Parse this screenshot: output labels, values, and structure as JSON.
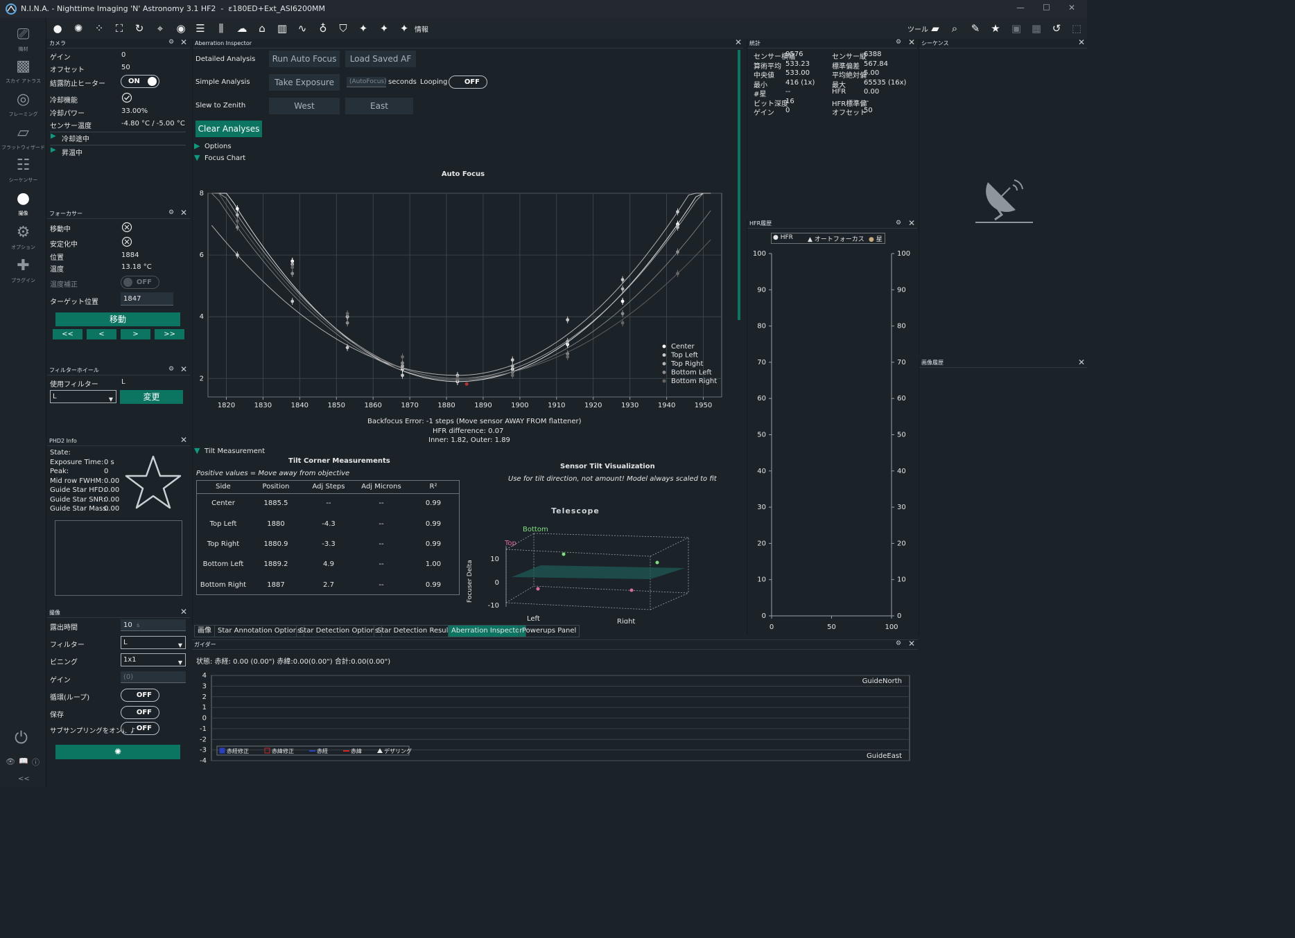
{
  "window": {
    "title": "N.I.N.A. - Nighttime Imaging 'N' Astronomy 3.1 HF2",
    "profile": "ε180ED+Ext_ASI6200MM"
  },
  "toolbar": {
    "info_label": "情報",
    "tools_label": "ツール",
    "left_icons": [
      "circle-icon",
      "aperture-icon",
      "dots-icon",
      "frame-icon",
      "rotate-icon",
      "telescope-icon",
      "target-icon",
      "list-icon",
      "sliders-icon",
      "cloud-icon",
      "observatory-icon",
      "bar-chart-icon",
      "wave-icon",
      "bulb-icon",
      "shield-icon",
      "puzzle-icon",
      "puzzle-icon",
      "puzzle-icon"
    ],
    "right_icons": [
      "flat-icon",
      "zoom-icon",
      "brush-icon",
      "star-icon",
      "af-icon",
      "grid-icon",
      "history-icon",
      "crop-icon"
    ]
  },
  "rail": {
    "items": [
      {
        "label": "機材",
        "icon": "equipment-icon"
      },
      {
        "label": "スカイ アトラス",
        "icon": "map-icon"
      },
      {
        "label": "フレーミング",
        "icon": "framing-icon"
      },
      {
        "label": "フラットウィザード",
        "icon": "flat-wizard-icon"
      },
      {
        "label": "シーケンサー",
        "icon": "sequencer-icon"
      },
      {
        "label": "撮像",
        "icon": "imaging-icon"
      },
      {
        "label": "オプション",
        "icon": "gears-icon"
      },
      {
        "label": "プラグイン",
        "icon": "plugin-icon"
      }
    ],
    "collapse_label": "<<"
  },
  "camera": {
    "title": "カメラ",
    "rows": [
      {
        "label": "ゲイン",
        "value": "0"
      },
      {
        "label": "オフセット",
        "value": "50"
      },
      {
        "label": "結露防止ヒーター",
        "value": "ON"
      },
      {
        "label": "冷却機能",
        "value": ""
      },
      {
        "label": "冷却パワー",
        "value": "33.00%"
      },
      {
        "label": "センサー温度",
        "value": "-4.80 °C / -5.00 °C"
      }
    ],
    "cooling": "冷却途中",
    "warming": "昇温中"
  },
  "focuser": {
    "title": "フォーカサー",
    "rows": [
      {
        "label": "移動中",
        "value": ""
      },
      {
        "label": "安定化中",
        "value": ""
      },
      {
        "label": "位置",
        "value": "1884"
      },
      {
        "label": "温度",
        "value": "13.18 °C"
      },
      {
        "label": "温度補正",
        "value": "OFF"
      }
    ],
    "target_label": "ターゲット位置",
    "target_value": "1847",
    "move_label": "移動",
    "step_buttons": [
      "<<",
      "<",
      ">",
      ">>"
    ]
  },
  "filterwheel": {
    "title": "フィルターホイール",
    "in_use_label": "使用フィルター",
    "in_use_value": "L",
    "selected": "L",
    "change_label": "変更"
  },
  "phd2": {
    "title": "PHD2 Info",
    "rows": [
      {
        "label": "State:",
        "value": ""
      },
      {
        "label": "Exposure Time:",
        "value": "0 s"
      },
      {
        "label": "Peak:",
        "value": "0"
      },
      {
        "label": "Mid row FWHM:",
        "value": "0.00"
      },
      {
        "label": "Guide Star HFD:",
        "value": "0.00"
      },
      {
        "label": "Guide Star SNR:",
        "value": "0.00"
      },
      {
        "label": "Guide Star Mass:",
        "value": "0.00"
      }
    ]
  },
  "imaging": {
    "title": "撮像",
    "exposure_label": "露出時間",
    "exposure_value": "10",
    "exposure_unit": "s",
    "filter_label": "フィルター",
    "filter_value": "L",
    "binning_label": "ビニング",
    "binning_value": "1x1",
    "gain_label": "ゲイン",
    "gain_placeholder": "(0)",
    "loop_label": "循環(ループ)",
    "loop_value": "OFF",
    "save_label": "保存",
    "save_value": "OFF",
    "subsample_label": "サブサンプリングをオンにす",
    "subsample_value": "OFF"
  },
  "aberration": {
    "title": "Aberration Inspector",
    "detailed_label": "Detailed Analysis",
    "run_af": "Run Auto Focus",
    "load_af": "Load Saved AF",
    "simple_label": "Simple Analysis",
    "take_exposure": "Take Exposure",
    "autofocus_placeholder": "(AutoFocus)",
    "seconds": "seconds",
    "looping_label": "Looping",
    "looping_value": "OFF",
    "slew_label": "Slew to Zenith",
    "west": "West",
    "east": "East",
    "clear": "Clear Analyses",
    "options": "Options",
    "focus_chart": "Focus Chart",
    "backfocus": "Backfocus Error: -1 steps (Move sensor AWAY FROM flattener)",
    "hfr_diff": "HFR difference: 0.07",
    "inner_outer": "Inner: 1.82, Outer: 1.89",
    "tilt_measurement": "Tilt Measurement",
    "tilt_title": "Tilt Corner Measurements",
    "tilt_note": "Positive values = Move away from objective",
    "tilt_headers": [
      "Side",
      "Position",
      "Adj Steps",
      "Adj Microns",
      "R²"
    ],
    "tilt_rows": [
      [
        "Center",
        "1885.5",
        "--",
        "--",
        "0.99"
      ],
      [
        "Top Left",
        "1880",
        "-4.3",
        "--",
        "0.99"
      ],
      [
        "Top Right",
        "1880.9",
        "-3.3",
        "--",
        "0.99"
      ],
      [
        "Bottom Left",
        "1889.2",
        "4.9",
        "--",
        "1.00"
      ],
      [
        "Bottom Right",
        "1887",
        "2.7",
        "--",
        "0.99"
      ]
    ],
    "viz_title": "Sensor Tilt Visualization",
    "viz_note": "Use for tilt direction, not amount! Model always scaled to fit",
    "viz_telescope": "Telescope",
    "viz_bottom": "Bottom",
    "viz_top": "Top",
    "viz_left": "Left",
    "viz_right": "Right",
    "viz_axis": "Focuser Delta",
    "viz_ticks": [
      "10",
      "0",
      "-10"
    ]
  },
  "chart_data": [
    {
      "type": "scatter",
      "title": "Auto Focus",
      "xlim": [
        1815,
        1955
      ],
      "ylim": [
        1.4,
        8
      ],
      "x_ticks": [
        1820,
        1830,
        1840,
        1850,
        1860,
        1870,
        1880,
        1890,
        1900,
        1910,
        1920,
        1930,
        1940,
        1950
      ],
      "y_ticks": [
        2,
        4,
        6,
        8
      ],
      "grid": true,
      "legend_position": "bottom-right",
      "series": [
        {
          "name": "Center",
          "color": "#ffffff",
          "x": [
            1823,
            1838,
            1853,
            1868,
            1883,
            1898,
            1913,
            1928,
            1943
          ],
          "y": [
            7.5,
            5.8,
            4.0,
            2.3,
            1.9,
            2.3,
            3.1,
            4.5,
            7.0
          ]
        },
        {
          "name": "Top Left",
          "color": "#c8c8c8",
          "x": [
            1823,
            1838,
            1853,
            1868,
            1883,
            1898,
            1913,
            1928,
            1943
          ],
          "y": [
            6.0,
            4.5,
            3.0,
            2.1,
            2.1,
            2.6,
            3.9,
            5.2,
            7.4
          ]
        },
        {
          "name": "Top Right",
          "color": "#b4b4b4",
          "x": [
            1823,
            1838,
            1853,
            1868,
            1883,
            1898,
            1913,
            1928,
            1943
          ],
          "y": [
            7.3,
            5.7,
            4.0,
            2.4,
            2.0,
            2.4,
            3.2,
            4.9,
            6.9
          ]
        },
        {
          "name": "Bottom Left",
          "color": "#8c8c8c",
          "x": [
            1823,
            1838,
            1853,
            1868,
            1883,
            1898,
            1913,
            1928,
            1943
          ],
          "y": [
            6.9,
            5.4,
            3.8,
            2.5,
            1.95,
            2.2,
            2.8,
            4.1,
            6.1
          ]
        },
        {
          "name": "Bottom Right",
          "color": "#666666",
          "x": [
            1823,
            1838,
            1853,
            1868,
            1883,
            1898,
            1913,
            1928,
            1943
          ],
          "y": [
            7.1,
            5.6,
            4.1,
            2.7,
            2.0,
            2.1,
            2.7,
            3.8,
            5.4
          ]
        }
      ],
      "minimum": {
        "x": 1885.5,
        "y": 1.82
      }
    },
    {
      "type": "line",
      "title": "HFR履歴",
      "legend": [
        "HFR",
        "オートフォーカス",
        "星"
      ],
      "xlim": [
        0,
        100
      ],
      "ylim": [
        0,
        100
      ],
      "x_ticks": [
        0,
        50,
        100
      ],
      "y_ticks": [
        0,
        10,
        20,
        30,
        40,
        50,
        60,
        70,
        80,
        90,
        100
      ],
      "series": []
    },
    {
      "type": "line",
      "title": "ガイダー",
      "ylim": [
        -4,
        4
      ],
      "y_ticks": [
        4,
        3,
        2,
        1,
        0,
        -1,
        -2,
        -3,
        -4
      ],
      "legend": [
        "赤経修正",
        "赤緯修正",
        "赤経",
        "赤緯",
        "デザリング"
      ],
      "annotations": [
        "GuideNorth",
        "GuideEast"
      ],
      "series": []
    }
  ],
  "tabs": [
    "画像",
    "Star Annotation Options",
    "Star Detection Options",
    "Star Detection Results",
    "Aberration Inspector",
    "Powerups Panel"
  ],
  "stats": {
    "title": "統計",
    "left": [
      {
        "label": "センサー横幅",
        "value": "9576"
      },
      {
        "label": "算術平均",
        "value": "533.23"
      },
      {
        "label": "中央値",
        "value": "533.00"
      },
      {
        "label": "最小",
        "value": "416 (1x)"
      },
      {
        "label": "#星",
        "value": "--"
      },
      {
        "label": "ビット深度",
        "value": "16"
      },
      {
        "label": "ゲイン",
        "value": "0"
      }
    ],
    "right": [
      {
        "label": "センサー縦",
        "value": "6388"
      },
      {
        "label": "標準偏差",
        "value": "567.84"
      },
      {
        "label": "平均絶対偏",
        "value": "5.00"
      },
      {
        "label": "最大",
        "value": "65535 (16x)"
      },
      {
        "label": "HFR",
        "value": "0.00"
      },
      {
        "label": "HFR標準偏",
        "value": "--"
      },
      {
        "label": "オフセット",
        "value": "50"
      }
    ]
  },
  "sequence_title": "シーケンス",
  "image_history_title": "画像履歴",
  "guider": {
    "title": "ガイダー",
    "status": "状態:  赤経: 0.00 (0.00\")  赤緯:0.00(0.00\")  合計:0.00(0.00\")"
  },
  "colors": {
    "accent": "#0b7561",
    "background": "#1b2329",
    "ra_color": "#2a3fbf",
    "dec_color": "#d02424"
  }
}
